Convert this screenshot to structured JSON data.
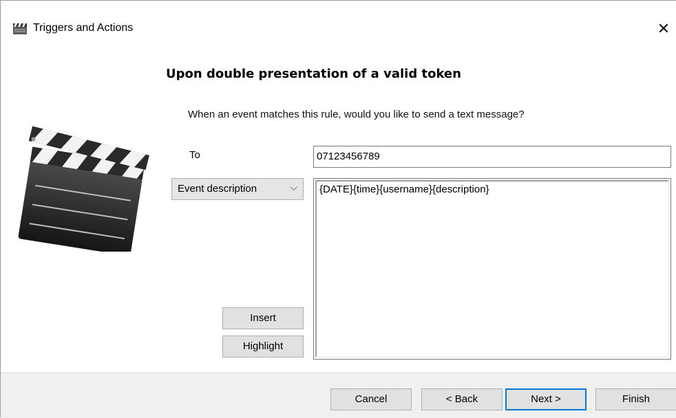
{
  "window": {
    "title": "Triggers and Actions",
    "close_glyph": "✕"
  },
  "page": {
    "heading": "Upon double presentation of a valid token",
    "prompt": "When an event matches this rule, would you like to send a text message?"
  },
  "form": {
    "to_label": "To",
    "to_value": "07123456789",
    "field_select": {
      "selected": "Event description",
      "chevron": "⌵"
    },
    "message_text": "{DATE}{time}{username}{description}",
    "insert_label": "Insert",
    "highlight_label": "Highlight"
  },
  "footer": {
    "cancel_label": "Cancel",
    "back_label": "< Back",
    "next_label": "Next >",
    "finish_label": "Finish"
  },
  "icons": {
    "title_icon": "clapperboard-icon",
    "illustration": "clapperboard-illustration"
  },
  "colors": {
    "accent": "#0078d7",
    "button_face": "#e1e1e1",
    "footer_bg": "#f0f0f0"
  }
}
